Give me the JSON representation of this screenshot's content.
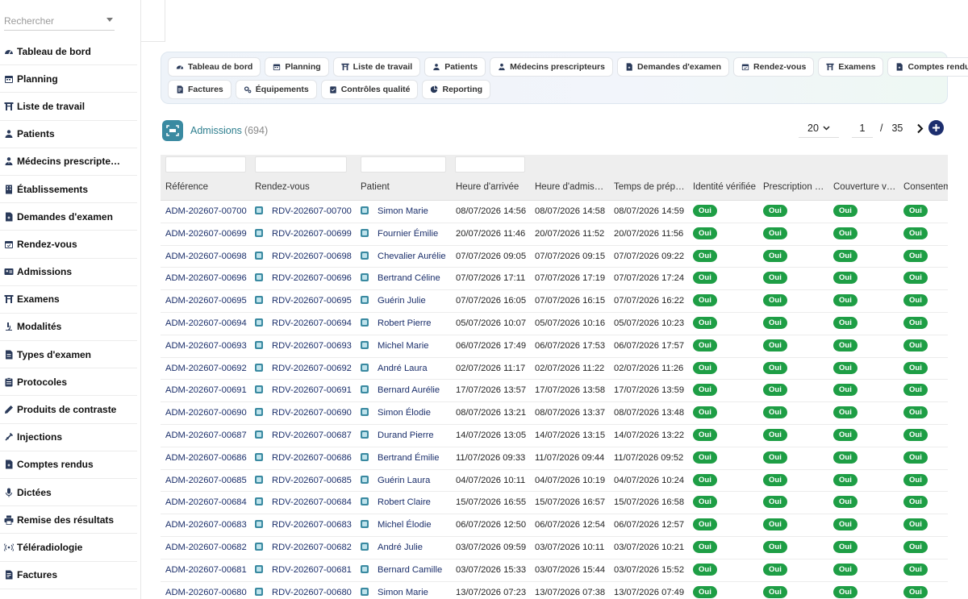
{
  "search": {
    "placeholder": "Rechercher"
  },
  "sidebar": {
    "items": [
      {
        "label": "Tableau de bord",
        "icon": "gauge-icon"
      },
      {
        "label": "Planning",
        "icon": "calendar-icon"
      },
      {
        "label": "Liste de travail",
        "icon": "worklist-icon"
      },
      {
        "label": "Patients",
        "icon": "user-icon"
      },
      {
        "label": "Médecins prescripte…",
        "icon": "doctor-icon"
      },
      {
        "label": "Établissements",
        "icon": "building-icon"
      },
      {
        "label": "Demandes d'examen",
        "icon": "request-icon"
      },
      {
        "label": "Rendez-vous",
        "icon": "calendar-check-icon"
      },
      {
        "label": "Admissions",
        "icon": "id-card-icon"
      },
      {
        "label": "Examens",
        "icon": "worklist-icon"
      },
      {
        "label": "Modalités",
        "icon": "microscope-icon"
      },
      {
        "label": "Types d'examen",
        "icon": "file-icon"
      },
      {
        "label": "Protocoles",
        "icon": "clipboard-icon"
      },
      {
        "label": "Produits de contraste",
        "icon": "pen-icon"
      },
      {
        "label": "Injections",
        "icon": "syringe-icon"
      },
      {
        "label": "Comptes rendus",
        "icon": "report-icon"
      },
      {
        "label": "Dictées",
        "icon": "microphone-icon"
      },
      {
        "label": "Remise des résultats",
        "icon": "printer-icon"
      },
      {
        "label": "Téléradiologie",
        "icon": "broadcast-icon"
      },
      {
        "label": "Factures",
        "icon": "invoice-icon"
      }
    ]
  },
  "quicknav": {
    "row1": [
      "Tableau de bord",
      "Planning",
      "Liste de travail",
      "Patients",
      "Médecins prescripteurs",
      "Demandes d'examen",
      "Rendez-vous",
      "Examens",
      "Comptes rendus"
    ],
    "row2": [
      "Factures",
      "Équipements",
      "Contrôles qualité",
      "Reporting"
    ]
  },
  "header": {
    "title": "Admissions",
    "count": "(694)"
  },
  "pager": {
    "page_size": "20",
    "current_page": "1",
    "separator": "/",
    "total_pages": "35"
  },
  "table": {
    "columns": [
      "Référence",
      "Rendez-vous",
      "Patient",
      "Heure d'arrivée",
      "Heure d'admis…",
      "Temps de prép…",
      "Identité vérifiée",
      "Prescription …",
      "Couverture v…",
      "Consentem"
    ],
    "badge_label": "Oui",
    "rows": [
      [
        "ADM-202607-00700",
        "RDV-202607-00700",
        "Simon Marie",
        "08/07/2026 14:56",
        "08/07/2026 14:58",
        "08/07/2026 14:59"
      ],
      [
        "ADM-202607-00699",
        "RDV-202607-00699",
        "Fournier Émilie",
        "20/07/2026 11:46",
        "20/07/2026 11:52",
        "20/07/2026 11:56"
      ],
      [
        "ADM-202607-00698",
        "RDV-202607-00698",
        "Chevalier Aurélie",
        "07/07/2026 09:05",
        "07/07/2026 09:15",
        "07/07/2026 09:22"
      ],
      [
        "ADM-202607-00696",
        "RDV-202607-00696",
        "Bertrand Céline",
        "07/07/2026 17:11",
        "07/07/2026 17:19",
        "07/07/2026 17:24"
      ],
      [
        "ADM-202607-00695",
        "RDV-202607-00695",
        "Guérin Julie",
        "07/07/2026 16:05",
        "07/07/2026 16:15",
        "07/07/2026 16:22"
      ],
      [
        "ADM-202607-00694",
        "RDV-202607-00694",
        "Robert Pierre",
        "05/07/2026 10:07",
        "05/07/2026 10:16",
        "05/07/2026 10:23"
      ],
      [
        "ADM-202607-00693",
        "RDV-202607-00693",
        "Michel Marie",
        "06/07/2026 17:49",
        "06/07/2026 17:53",
        "06/07/2026 17:57"
      ],
      [
        "ADM-202607-00692",
        "RDV-202607-00692",
        "André Laura",
        "02/07/2026 11:17",
        "02/07/2026 11:22",
        "02/07/2026 11:26"
      ],
      [
        "ADM-202607-00691",
        "RDV-202607-00691",
        "Bernard Aurélie",
        "17/07/2026 13:57",
        "17/07/2026 13:58",
        "17/07/2026 13:59"
      ],
      [
        "ADM-202607-00690",
        "RDV-202607-00690",
        "Simon Élodie",
        "08/07/2026 13:21",
        "08/07/2026 13:37",
        "08/07/2026 13:48"
      ],
      [
        "ADM-202607-00687",
        "RDV-202607-00687",
        "Durand Pierre",
        "14/07/2026 13:05",
        "14/07/2026 13:15",
        "14/07/2026 13:22"
      ],
      [
        "ADM-202607-00686",
        "RDV-202607-00686",
        "Bertrand Émilie",
        "11/07/2026 09:33",
        "11/07/2026 09:44",
        "11/07/2026 09:52"
      ],
      [
        "ADM-202607-00685",
        "RDV-202607-00685",
        "Guérin Laura",
        "04/07/2026 10:11",
        "04/07/2026 10:19",
        "04/07/2026 10:24"
      ],
      [
        "ADM-202607-00684",
        "RDV-202607-00684",
        "Robert Claire",
        "15/07/2026 16:55",
        "15/07/2026 16:57",
        "15/07/2026 16:58"
      ],
      [
        "ADM-202607-00683",
        "RDV-202607-00683",
        "Michel Élodie",
        "06/07/2026 12:50",
        "06/07/2026 12:54",
        "06/07/2026 12:57"
      ],
      [
        "ADM-202607-00682",
        "RDV-202607-00682",
        "André Julie",
        "03/07/2026 09:59",
        "03/07/2026 10:11",
        "03/07/2026 10:21"
      ],
      [
        "ADM-202607-00681",
        "RDV-202607-00681",
        "Bernard Camille",
        "03/07/2026 15:33",
        "03/07/2026 15:44",
        "03/07/2026 15:52"
      ],
      [
        "ADM-202607-00680",
        "RDV-202607-00680",
        "Simon Marie",
        "13/07/2026 07:23",
        "13/07/2026 07:38",
        "13/07/2026 07:49"
      ]
    ]
  }
}
